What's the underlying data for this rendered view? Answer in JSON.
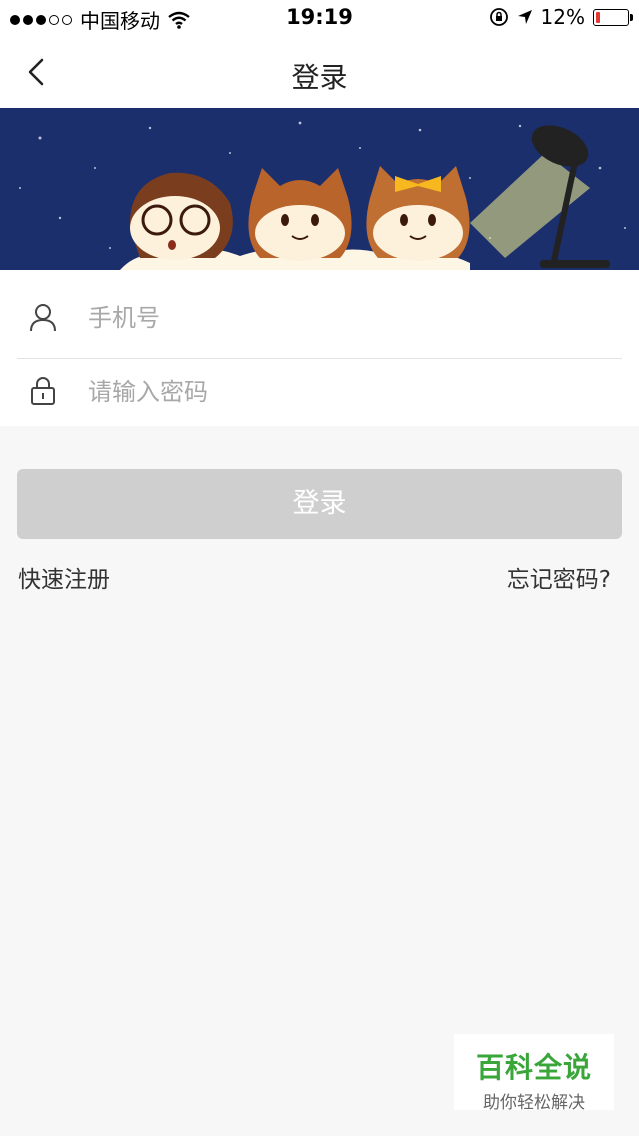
{
  "status_bar": {
    "carrier": "中国移动",
    "time": "19:19",
    "battery_percent": "12%",
    "battery_level": 0.12,
    "battery_color": "#e53935"
  },
  "nav": {
    "title": "登录",
    "back_icon": "chevron-left-icon"
  },
  "form": {
    "phone_placeholder": "手机号",
    "phone_icon": "user-icon",
    "password_placeholder": "请输入密码",
    "password_icon": "lock-icon"
  },
  "actions": {
    "login_label": "登录",
    "register_label": "快速注册",
    "forgot_label": "忘记密码?"
  },
  "watermark": {
    "title": "百科全说",
    "subtitle": "助你轻松解决"
  },
  "colors": {
    "banner_bg": "#1c2f6d",
    "button_disabled": "#cfcfcf",
    "watermark_green": "#3aa63a"
  }
}
